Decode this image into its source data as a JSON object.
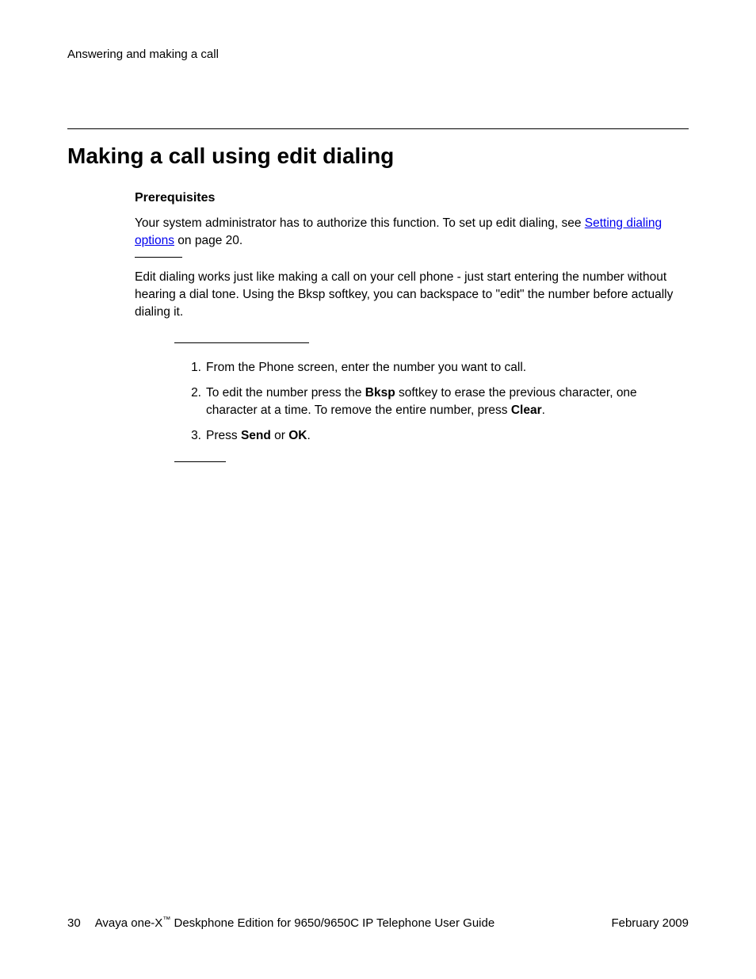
{
  "header": {
    "breadcrumb": "Answering and making a call"
  },
  "main": {
    "heading": "Making a call using edit dialing",
    "prerequisites_heading": "Prerequisites",
    "prereq_para_part1": "Your system administrator has to authorize this function. To set up edit dialing, see ",
    "prereq_link": "Setting dialing options",
    "prereq_para_part2": " on page 20.",
    "description": "Edit dialing works just like making a call on your cell phone - just start entering the number without hearing a dial tone. Using the Bksp softkey, you can backspace to \"edit\" the number before actually dialing it.",
    "steps": [
      {
        "number": "1.",
        "segments": [
          {
            "text": "From the Phone screen, enter the number you want to call.",
            "bold": false
          }
        ]
      },
      {
        "number": "2.",
        "segments": [
          {
            "text": "To edit the number press the ",
            "bold": false
          },
          {
            "text": "Bksp",
            "bold": true
          },
          {
            "text": " softkey to erase the previous character, one character at a time. To remove the entire number, press ",
            "bold": false
          },
          {
            "text": "Clear",
            "bold": true
          },
          {
            "text": ".",
            "bold": false
          }
        ]
      },
      {
        "number": "3.",
        "segments": [
          {
            "text": "Press ",
            "bold": false
          },
          {
            "text": "Send",
            "bold": true
          },
          {
            "text": " or ",
            "bold": false
          },
          {
            "text": "OK",
            "bold": true
          },
          {
            "text": ".",
            "bold": false
          }
        ]
      }
    ]
  },
  "footer": {
    "page_number": "30",
    "title_part1": "Avaya one-X",
    "trademark": "™",
    "title_part2": " Deskphone Edition for 9650/9650C IP Telephone User Guide",
    "date": "February 2009"
  }
}
